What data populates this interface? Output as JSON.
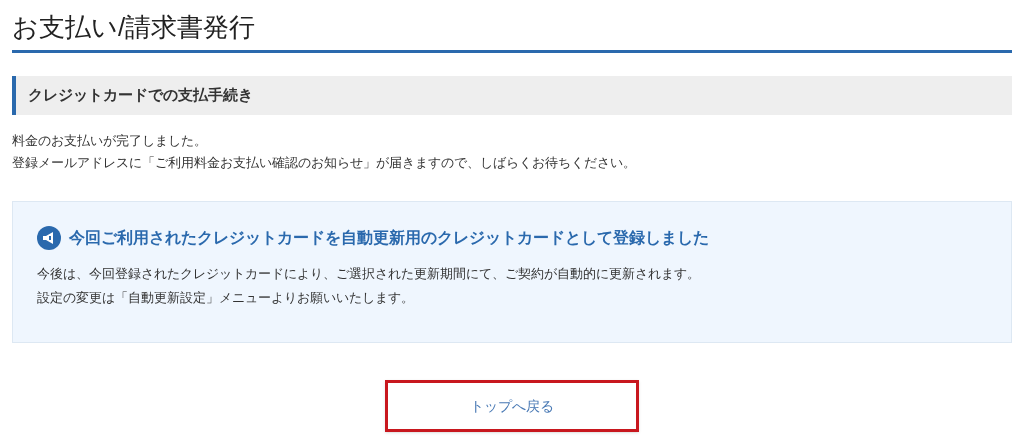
{
  "page_title": "お支払い/請求書発行",
  "section": {
    "heading": "クレジットカードでの支払手続き"
  },
  "message_lines": [
    "料金のお支払いが完了しました。",
    "登録メールアドレスに「ご利用料金お支払い確認のお知らせ」が届きますので、しばらくお待ちください。"
  ],
  "notice": {
    "title": "今回ご利用されたクレジットカードを自動更新用のクレジットカードとして登録しました",
    "lines": [
      "今後は、今回登録されたクレジットカードにより、ご選択された更新期間にて、ご契約が自動的に更新されます。",
      "設定の変更は「自動更新設定」メニューよりお願いいたします。"
    ]
  },
  "button": {
    "label": "トップへ戻る"
  }
}
